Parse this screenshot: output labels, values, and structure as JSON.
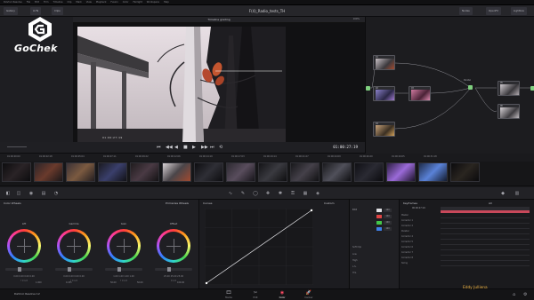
{
  "menubar": {
    "items": [
      "DaVinci Resolve",
      "File",
      "Edit",
      "Trim",
      "Timeline",
      "Clip",
      "Mark",
      "View",
      "Playback",
      "Fusion",
      "Color",
      "Fairlight",
      "Workspace",
      "Help"
    ]
  },
  "toolbar": {
    "left_buttons": [
      "Gallery",
      "LUTs",
      "Clips"
    ],
    "project_title": "F(4)_Radio_tests_TH",
    "right_buttons": [
      "Nodes",
      "OpenFX",
      "Lightbox"
    ],
    "viewer_title": "Timeline grading",
    "viewer_zoom": "100%"
  },
  "logo": {
    "text": "GoChek"
  },
  "viewer": {
    "overlay_timecode": "01:00:27:19",
    "timecode": "01:00:27:19",
    "transport": [
      "⏮",
      "◀◀",
      "◀",
      "■",
      "▶",
      "▶▶",
      "⏭",
      "⟲"
    ]
  },
  "nodes": {
    "items": [
      {
        "label": "01"
      },
      {
        "label": "02"
      },
      {
        "label": "03"
      },
      {
        "label": "04"
      },
      {
        "label": "05"
      },
      {
        "label": "06"
      },
      {
        "label": "07"
      }
    ],
    "mixer_label": "Parallel"
  },
  "clips": {
    "timecodes": [
      "01:00:00:00",
      "01:00:02:18",
      "01:00:05:04",
      "01:00:07:11",
      "01:00:09:22",
      "01:00:12:06",
      "01:00:14:19",
      "01:00:17:03",
      "01:00:19:14",
      "01:00:21:27",
      "01:00:24:09",
      "01:00:26:20",
      "01:00:29:05",
      "01:00:31:18"
    ]
  },
  "color_wheels": {
    "title": "Color Wheels",
    "mode": "Primaries Wheels",
    "wheels": [
      {
        "name": "Lift",
        "values": "0.00  0.00  0.00  0.00",
        "channels": "Y  R  G  B"
      },
      {
        "name": "Gamma",
        "values": "0.00  0.00  0.00  0.00",
        "channels": "Y  R  G  B"
      },
      {
        "name": "Gain",
        "values": "1.00  1.00  1.00  1.00",
        "channels": "Y  R  G  B"
      },
      {
        "name": "Offset",
        "values": "25.00  25.00  25.00",
        "channels": "R  G  B"
      }
    ],
    "bottom": {
      "contrast": "1.000",
      "pivot": "0.435",
      "sat": "50.00",
      "hue": "50.00",
      "lum_mix": "100.00"
    }
  },
  "curves": {
    "title": "Curves",
    "mode": "Custom",
    "edit_label": "Edit",
    "values": [
      "100",
      "100",
      "100",
      "100"
    ],
    "soft_clip": "Soft Clip",
    "low": "Low",
    "high": "High",
    "ls": "L.S.",
    "hs": "H.S."
  },
  "keyframes": {
    "title": "Keyframes",
    "filter": "All",
    "timecode": "00:00:27:19",
    "rows": [
      "Master",
      "Corrector 1",
      "Corrector 2",
      "Parallel",
      "Corrector 4",
      "Corrector 5",
      "Corrector 6",
      "Corrector 7",
      "Corrector 8",
      "Sizing"
    ]
  },
  "pages": {
    "items": [
      {
        "label": "Media",
        "icon": "🎞"
      },
      {
        "label": "Edit",
        "icon": "✂"
      },
      {
        "label": "Color",
        "icon": "◉"
      },
      {
        "label": "Deliver",
        "icon": "🚀"
      }
    ],
    "app_name": "DaVinci Resolve 12",
    "user_name": "Eddy Julliena"
  },
  "colors": {
    "accent": "#ff4b64",
    "user": "#f0b443",
    "node_green": "#7fd07f"
  }
}
